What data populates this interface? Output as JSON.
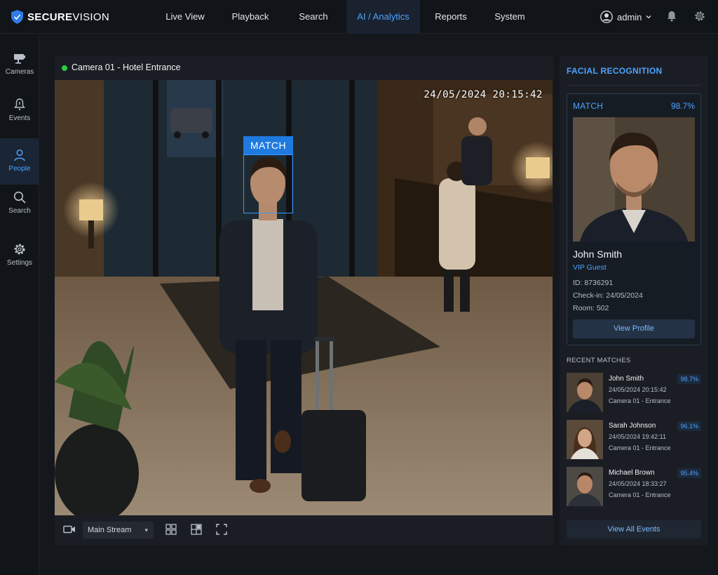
{
  "brand": {
    "name_bold": "SECURE",
    "name_regular": "VISION",
    "icon": "shield-icon"
  },
  "nav": [
    {
      "label": "Live View"
    },
    {
      "label": "Playback"
    },
    {
      "label": "Search"
    },
    {
      "label": "AI / Analytics",
      "active": true
    },
    {
      "label": "Reports"
    },
    {
      "label": "System"
    }
  ],
  "user": {
    "name": "admin",
    "icons": [
      "user-icon",
      "chevron-down-icon",
      "bell-icon",
      "gear-icon"
    ]
  },
  "sidebar": {
    "items": [
      {
        "label": "Cameras",
        "icon": "camera-icon"
      },
      {
        "label": "Events",
        "icon": "alert-icon"
      },
      {
        "label": "People",
        "icon": "person-icon",
        "active": true
      },
      {
        "label": "Search",
        "icon": "search-icon"
      },
      {
        "label": "Settings",
        "icon": "gear-icon"
      }
    ]
  },
  "camera": {
    "title": "Camera 01 - Hotel Entrance",
    "status_color": "#2ecc40",
    "timestamp": "24/05/2024  20:15:42",
    "detection_label": "MATCH",
    "stream": "Main Stream",
    "controls": [
      "video-camera-icon",
      "layout-grid-icon",
      "layout-split-icon",
      "fullscreen-icon"
    ]
  },
  "facial_recognition": {
    "title": "FACIAL RECOGNITION",
    "match_label": "MATCH",
    "score": "98.7%",
    "name": "John Smith",
    "tag": "VIP Guest",
    "id": "ID: 8736291",
    "checkin": "Check-in: 24/05/2024",
    "room": "Room: 502",
    "button": "View Profile"
  },
  "recent": {
    "title": "RECENT MATCHES",
    "items": [
      {
        "name": "John Smith",
        "time": "24/05/2024   20:15:42",
        "camera": "Camera 01 - Entrance",
        "score": "98.7%"
      },
      {
        "name": "Sarah Johnson",
        "time": "24/05/2024   19:42:11",
        "camera": "Camera 01 - Entrance",
        "score": "96.1%"
      },
      {
        "name": "Michael Brown",
        "time": "24/05/2024   18:33:27",
        "camera": "Camera 01 - Entrance",
        "score": "95.4%"
      }
    ],
    "button": "View All Events"
  },
  "colors": {
    "accent": "#4da3ff",
    "background": "#14171c",
    "panel": "#1a1e24",
    "match_box": "#3d94ff"
  }
}
